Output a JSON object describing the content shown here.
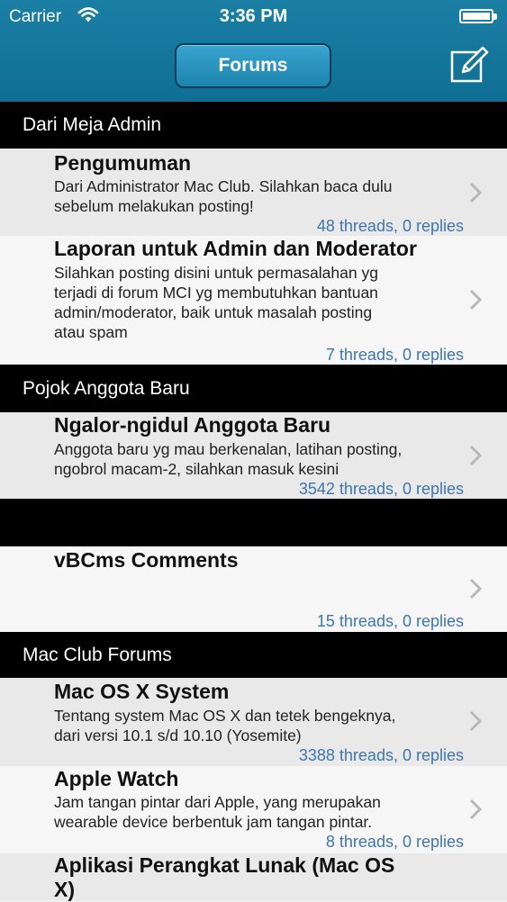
{
  "status_bar": {
    "carrier": "Carrier",
    "time": "3:36 PM",
    "icons": [
      "wifi-icon",
      "battery-icon"
    ]
  },
  "nav": {
    "title": "Forums",
    "compose_icon": "compose-icon"
  },
  "colors": {
    "nav_bg": "#1577a0",
    "section_header_bg": "#000000",
    "meta_text": "#3d76b0"
  },
  "sections": [
    {
      "header": "Dari Meja Admin",
      "forums": [
        {
          "title": "Pengumuman",
          "description": "Dari Administrator  Mac Club. Silahkan baca dulu\nsebelum melakukan posting!",
          "stats": "48 threads, 0 replies"
        },
        {
          "title": "Laporan untuk Admin dan Moderator",
          "description": "Silahkan posting disini untuk permasalahan yg\nterjadi di forum MCI yg membutuhkan bantuan\nadmin/moderator, baik untuk masalah posting\natau spam",
          "stats": "7 threads, 0 replies"
        }
      ]
    },
    {
      "header": "Pojok Anggota Baru",
      "forums": [
        {
          "title": "Ngalor-ngidul Anggota Baru",
          "description": "Anggota baru yg mau berkenalan, latihan posting,\nngobrol macam-2, silahkan masuk kesini",
          "stats": "3542 threads, 0 replies"
        }
      ]
    },
    {
      "header": "",
      "forums": [
        {
          "title": "vBCms Comments",
          "description": "",
          "stats": "15 threads, 0 replies"
        }
      ]
    },
    {
      "header": "Mac Club Forums",
      "forums": [
        {
          "title": "Mac OS X System",
          "description": "Tentang system Mac OS X dan tetek bengeknya,\ndari  versi 10.1 s/d 10.10 (Yosemite)",
          "stats": "3388 threads, 0 replies"
        },
        {
          "title": "Apple Watch",
          "description": "Jam tangan pintar dari Apple, yang merupakan\nwearable device berbentuk jam tangan pintar.",
          "stats": "8 threads, 0 replies"
        },
        {
          "title": "Aplikasi Perangkat Lunak (Mac OS\nX)",
          "description": "",
          "stats": ""
        }
      ]
    }
  ]
}
